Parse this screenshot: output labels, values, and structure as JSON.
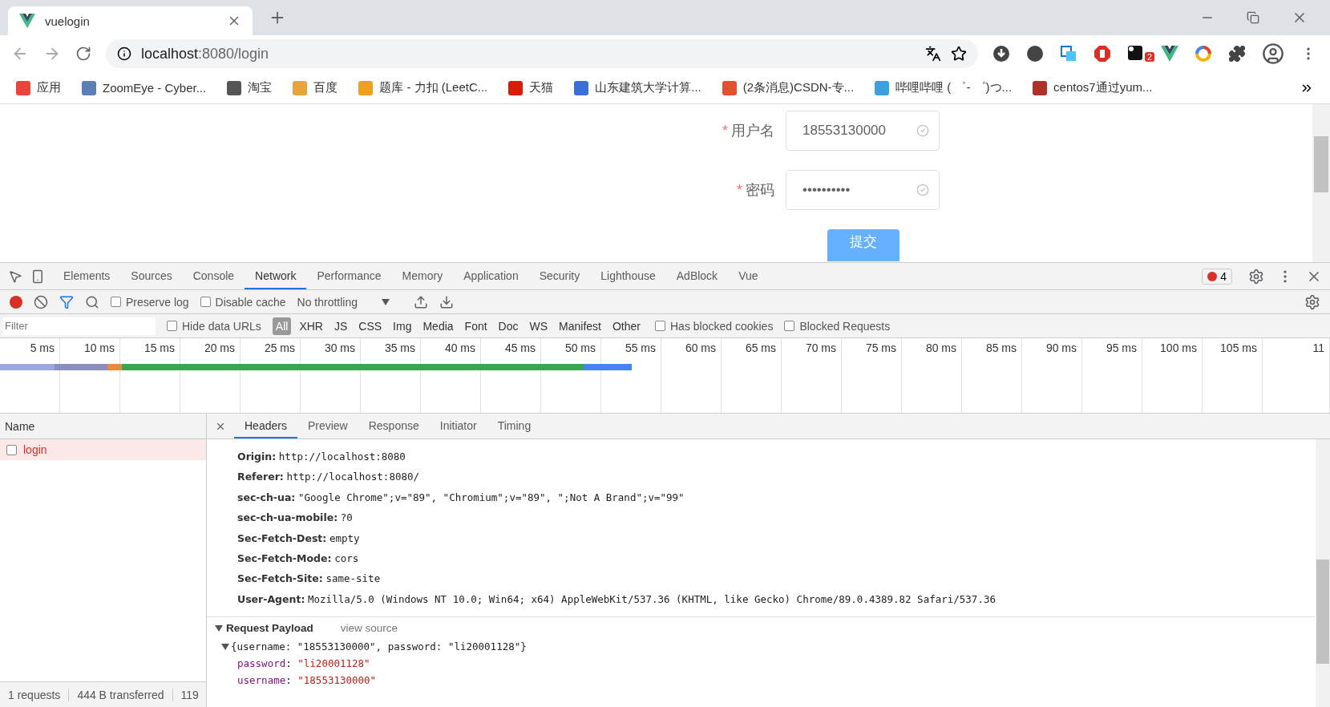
{
  "browser": {
    "tab": {
      "title": "vuelogin"
    },
    "address": {
      "host": "localhost",
      "path": ":8080/login"
    },
    "extension_badge": "2",
    "bookmarks": [
      {
        "label": "应用",
        "color": "#e8453c"
      },
      {
        "label": "ZoomEye - Cyber...",
        "color": "#5b7fb5"
      },
      {
        "label": "淘宝",
        "color": "#555555"
      },
      {
        "label": "百度",
        "color": "#e8a33c"
      },
      {
        "label": "题库 - 力扣 (LeetC...",
        "color": "#f0a020"
      },
      {
        "label": "天猫",
        "color": "#d81e06"
      },
      {
        "label": "山东建筑大学计算...",
        "color": "#3a6fd8"
      },
      {
        "label": "(2条消息)CSDN-专...",
        "color": "#e2522e"
      },
      {
        "label": "哔哩哔哩 ( ゜- ゜)つ...",
        "color": "#3aa0e0"
      },
      {
        "label": "centos7通过yum...",
        "color": "#b0302a"
      }
    ]
  },
  "page": {
    "fields": [
      {
        "label": "用户名",
        "required": true,
        "marker": "*",
        "value": "18553130000",
        "valid": true
      },
      {
        "label": "密码",
        "required": true,
        "marker": "*",
        "value": "••••••••••",
        "valid": true
      }
    ],
    "submit": "提交"
  },
  "devtools": {
    "tabs": [
      {
        "label": "Elements",
        "selected": false
      },
      {
        "label": "Sources",
        "selected": false
      },
      {
        "label": "Console",
        "selected": false
      },
      {
        "label": "Network",
        "selected": true
      },
      {
        "label": "Performance",
        "selected": false
      },
      {
        "label": "Memory",
        "selected": false
      },
      {
        "label": "Application",
        "selected": false
      },
      {
        "label": "Security",
        "selected": false
      },
      {
        "label": "Lighthouse",
        "selected": false
      },
      {
        "label": "AdBlock",
        "selected": false
      },
      {
        "label": "Vue",
        "selected": false
      }
    ],
    "error_count": "4",
    "toolbar": {
      "recording": true,
      "filter_active": true,
      "checks": [
        {
          "label": "Preserve log",
          "checked": false
        },
        {
          "label": "Disable cache",
          "checked": false
        }
      ],
      "throttling": "No throttling"
    },
    "filter": {
      "placeholder": "Filter",
      "hide_data_urls": {
        "label": "Hide data URLs",
        "checked": false
      },
      "types": [
        {
          "label": "All",
          "selected": true
        },
        {
          "label": "XHR",
          "selected": false
        },
        {
          "label": "JS",
          "selected": false
        },
        {
          "label": "CSS",
          "selected": false
        },
        {
          "label": "Img",
          "selected": false
        },
        {
          "label": "Media",
          "selected": false
        },
        {
          "label": "Font",
          "selected": false
        },
        {
          "label": "Doc",
          "selected": false
        },
        {
          "label": "WS",
          "selected": false
        },
        {
          "label": "Manifest",
          "selected": false
        },
        {
          "label": "Other",
          "selected": false
        }
      ],
      "extra_checks": [
        {
          "label": "Has blocked cookies",
          "checked": false
        },
        {
          "label": "Blocked Requests",
          "checked": false
        }
      ]
    },
    "timeline": {
      "ticks": [
        "5 ms",
        "10 ms",
        "15 ms",
        "20 ms",
        "25 ms",
        "30 ms",
        "35 ms",
        "40 ms",
        "45 ms",
        "50 ms",
        "55 ms",
        "60 ms",
        "65 ms",
        "70 ms",
        "75 ms",
        "80 ms",
        "85 ms",
        "90 ms",
        "95 ms",
        "100 ms",
        "105 ms",
        "11"
      ]
    },
    "requests": {
      "column": "Name",
      "rows": [
        {
          "name": "login",
          "selected": true,
          "error": true
        }
      ]
    },
    "detail_tabs": [
      {
        "label": "Headers",
        "selected": true
      },
      {
        "label": "Preview",
        "selected": false
      },
      {
        "label": "Response",
        "selected": false
      },
      {
        "label": "Initiator",
        "selected": false
      },
      {
        "label": "Timing",
        "selected": false
      }
    ],
    "headers": [
      {
        "name": "Origin:",
        "value": "http://localhost:8080"
      },
      {
        "name": "Referer:",
        "value": "http://localhost:8080/"
      },
      {
        "name": "sec-ch-ua:",
        "value": "\"Google Chrome\";v=\"89\", \"Chromium\";v=\"89\", \";Not A Brand\";v=\"99\""
      },
      {
        "name": "sec-ch-ua-mobile:",
        "value": "?0"
      },
      {
        "name": "Sec-Fetch-Dest:",
        "value": "empty"
      },
      {
        "name": "Sec-Fetch-Mode:",
        "value": "cors"
      },
      {
        "name": "Sec-Fetch-Site:",
        "value": "same-site"
      },
      {
        "name": "User-Agent:",
        "value": "Mozilla/5.0 (Windows NT 10.0; Win64; x64) AppleWebKit/537.36 (KHTML, like Gecko) Chrome/89.0.4389.82 Safari/537.36"
      }
    ],
    "payload": {
      "title": "Request Payload",
      "expanded": true,
      "view_source": "view source",
      "summary": "{username: \"18553130000\", password: \"li20001128\"}",
      "summary_expanded": true,
      "fields": [
        {
          "key": "password",
          "sep": ":",
          "value": "\"li20001128\""
        },
        {
          "key": "username",
          "sep": ":",
          "value": "\"18553130000\""
        }
      ]
    },
    "status": [
      "1 requests",
      "444 B transferred",
      "119"
    ]
  }
}
